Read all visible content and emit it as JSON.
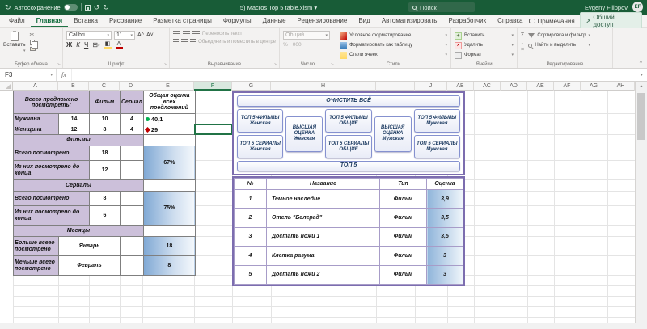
{
  "titlebar": {
    "autosave": "Автосохранение",
    "filename": "5) Macros Top 5 table.xlsm",
    "search": "Поиск",
    "user": "Evgeny Filippov",
    "initials": "EF"
  },
  "tabs": {
    "items": [
      "Файл",
      "Главная",
      "Вставка",
      "Рисование",
      "Разметка страницы",
      "Формулы",
      "Данные",
      "Рецензирование",
      "Вид",
      "Автоматизировать",
      "Разработчик",
      "Справка"
    ],
    "active": "Главная",
    "comments": "Примечания",
    "share": "Общий доступ"
  },
  "ribbon": {
    "paste": "Вставить",
    "clipboard_group": "Буфер обмена",
    "font_name": "Calibri",
    "font_size": "11",
    "bold": "Ж",
    "italic": "К",
    "underline": "Ч",
    "grow": "А^",
    "shrink": "А˅",
    "font_group": "Шрифт",
    "wrap_text": "Переносить текст",
    "merge_center": "Объединить и поместить в центре",
    "alignment_group": "Выравнивание",
    "number_format": "Общий",
    "percent": "%",
    "thousands": "000",
    "number_group": "Число",
    "cond_format": "Условное форматирование",
    "format_table": "Форматировать как таблицу",
    "cell_styles": "Стили ячеек",
    "styles_group": "Стили",
    "insert": "Вставить",
    "delete": "Удалить",
    "format": "Формат",
    "cells_group": "Ячейки",
    "autosum": "Σ",
    "sort_filter": "Сортировка и фильтр",
    "find_select": "Найти и выделить",
    "editing_group": "Редактирование"
  },
  "formula_bar": {
    "name_box": "F3",
    "fx": "fx",
    "value": ""
  },
  "grid": {
    "column_letters": [
      "A",
      "B",
      "C",
      "D",
      "E",
      "F",
      "G",
      "H",
      "I",
      "J",
      "AB",
      "AC",
      "AD",
      "AE",
      "AF",
      "AG",
      "AH"
    ],
    "active_column": "F",
    "row_numbers": [
      "1",
      "2",
      "3",
      "4",
      "5",
      "6",
      "7",
      "8",
      "9",
      "10",
      "11",
      "12",
      "13",
      "14",
      "15",
      "16",
      "17"
    ],
    "active_row": "3"
  },
  "sheet": {
    "summary": {
      "header": "Всего предложено посмотреть:",
      "col_film": "Фильм",
      "col_series": "Сериал",
      "col_score": "Общая оценка всех предложений",
      "male": {
        "label": "Мужчина",
        "total": "14",
        "films": "10",
        "series": "4",
        "score": "40,1"
      },
      "female": {
        "label": "Женщина",
        "total": "12",
        "films": "8",
        "series": "4",
        "score": "29"
      }
    },
    "films": {
      "band": "Фильмы",
      "watched_label": "Всего посмотрено",
      "watched": "18",
      "finished_label": "Из них посмотрено до конца",
      "finished": "12",
      "percent": "67%"
    },
    "series": {
      "band": "Сериалы",
      "watched_label": "Всего посмотрено",
      "watched": "8",
      "finished_label": "Из них посмотрено до конца",
      "finished": "6",
      "percent": "75%"
    },
    "months": {
      "band": "Месяцы",
      "most_label": "Больше всего посмотрено",
      "most_month": "Январь",
      "most_value": "18",
      "least_label": "Меньше всего посмотрено",
      "least_month": "Февраль",
      "least_value": "8"
    }
  },
  "panel": {
    "clear_all": "ОЧИСТИТЬ ВСЁ",
    "films_female": "ТОП 5 ФИЛЬМЫ\nЖенская",
    "series_female": "ТОП 5 СЕРИАЛЫ\nЖенская",
    "high_female": "ВЫСШАЯ\nОЦЕНКА\nЖенская",
    "films_common": "ТОП 5 ФИЛЬМЫ\nОБЩИЕ",
    "series_common": "ТОП 5 СЕРИАЛЫ\nОБЩИЕ",
    "high_male": "ВЫСШАЯ\nОЦЕНКА\nМужская",
    "films_male": "ТОП 5 ФИЛЬМЫ\nМужская",
    "series_male": "ТОП 5 СЕРИАЛЫ\nМужская",
    "top5": "ТОП 5",
    "table": {
      "headers": [
        "№",
        "Название",
        "Тип",
        "Оценка"
      ],
      "rows": [
        [
          "1",
          "Темное наследие",
          "Фильм",
          "3,9"
        ],
        [
          "2",
          "Отель \"Белград\"",
          "Фильм",
          "3,5"
        ],
        [
          "3",
          "Достать ножи 1",
          "Фильм",
          "3,5"
        ],
        [
          "4",
          "Клетка разума",
          "Фильм",
          "3"
        ],
        [
          "5",
          "Достать ножи 2",
          "Фильм",
          "3"
        ]
      ]
    }
  },
  "colors": {
    "titlebar_green": "#185c37",
    "accent_green": "#217346",
    "lavender": "#ccc0da",
    "gradient_blue": "#7fa8d4",
    "panel_border": "#7c6daf",
    "button_border": "#8591cf",
    "button_text": "#17365d"
  }
}
